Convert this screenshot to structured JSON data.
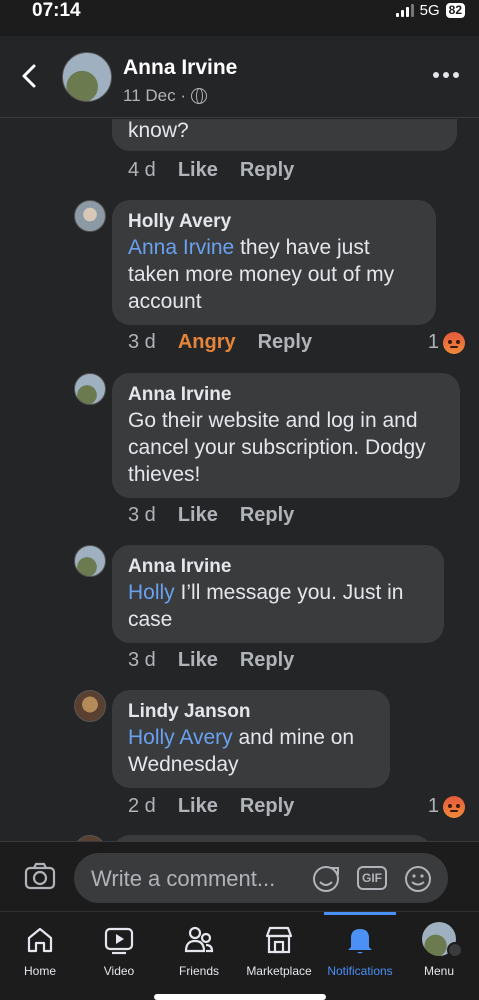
{
  "status_bar": {
    "time": "07:14",
    "network": "5G",
    "battery": "82"
  },
  "header": {
    "name": "Anna Irvine",
    "date": "11 Dec ·"
  },
  "partial_comment": {
    "text": "know?",
    "time": "4 d",
    "like": "Like",
    "reply": "Reply"
  },
  "comments": [
    {
      "author": "Holly Avery",
      "mention": "Anna Irvine",
      "text": " they have just taken more money out of my account",
      "time": "3 d",
      "reaction_label": "Angry",
      "reply": "Reply",
      "reaction_count": "1"
    },
    {
      "author": "Anna Irvine",
      "mention": "",
      "text": "Go their website and log in and cancel your subscription. Dodgy thieves!",
      "time": "3 d",
      "like": "Like",
      "reply": "Reply"
    },
    {
      "author": "Anna Irvine",
      "mention": "Holly",
      "text": " I’ll message you. Just in case",
      "time": "3 d",
      "like": "Like",
      "reply": "Reply"
    },
    {
      "author": "Lindy Janson",
      "mention": "Holly Avery",
      "text": " and mine on Wednesday",
      "time": "2 d",
      "like": "Like",
      "reply": "Reply",
      "reaction_count": "1"
    }
  ],
  "composer": {
    "placeholder": "Write a comment...",
    "gif": "GIF"
  },
  "nav": {
    "home": "Home",
    "video": "Video",
    "friends": "Friends",
    "marketplace": "Marketplace",
    "notifications": "Notifications",
    "menu": "Menu"
  },
  "colors": {
    "mention": "#6aa0f0",
    "angry": "#e6843a",
    "active": "#4a90f5",
    "background": "#242526",
    "bubble": "#3a3b3c"
  }
}
